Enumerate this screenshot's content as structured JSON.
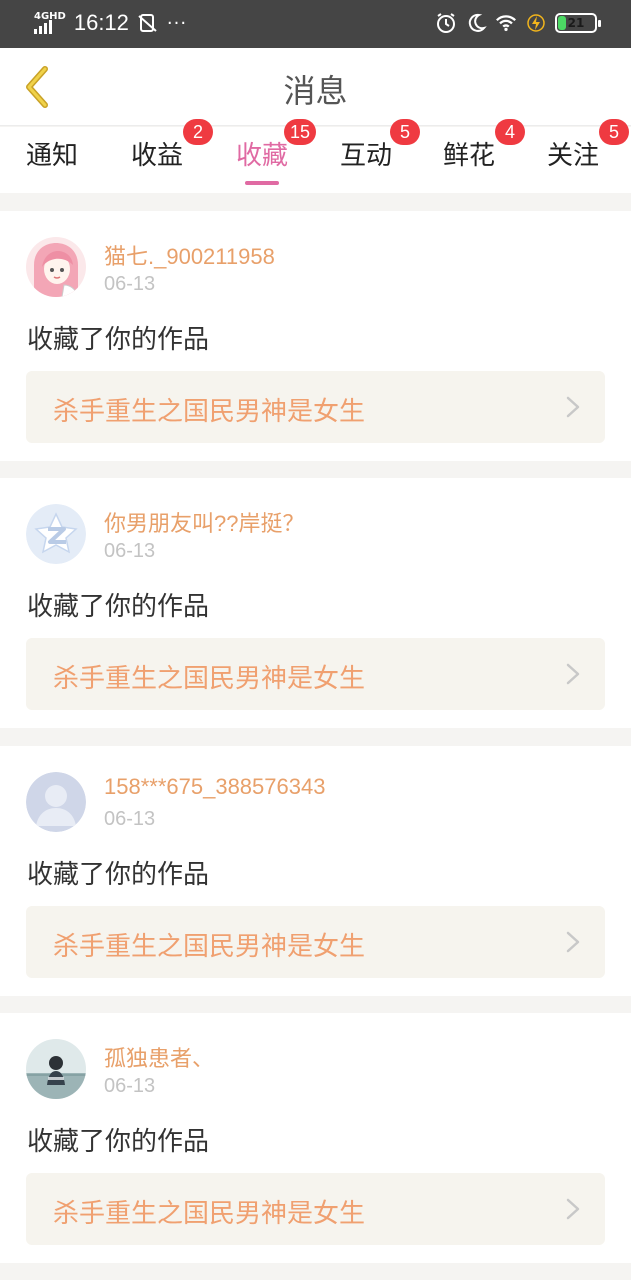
{
  "status_bar": {
    "network": "4GHD",
    "time": "16:12",
    "sim_icon": "sim-off-icon",
    "more": "···",
    "battery": "21"
  },
  "header": {
    "title": "消息"
  },
  "tabs": [
    {
      "label": "通知",
      "badge": ""
    },
    {
      "label": "收益",
      "badge": "2"
    },
    {
      "label": "收藏",
      "badge": "15",
      "active": true
    },
    {
      "label": "互动",
      "badge": "5"
    },
    {
      "label": "鲜花",
      "badge": "4"
    },
    {
      "label": "关注",
      "badge": "5"
    }
  ],
  "colors": {
    "accent": "#e06aa3",
    "badge": "#ef3a41",
    "username": "#e8a06a",
    "work_title": "#f0a070"
  },
  "items": [
    {
      "username": "猫七._900211958",
      "date": "06-13",
      "action": "收藏了你的作品",
      "work": "杀手重生之国民男神是女生",
      "avatar": "anime-girl-avatar"
    },
    {
      "username": "你男朋友叫??岸挺？",
      "date": "06-13",
      "action": "收藏了你的作品",
      "work": "杀手重生之国民男神是女生",
      "avatar": "qzone-star-avatar"
    },
    {
      "username": "158***675_388576343",
      "date": "06-13",
      "action": "收藏了你的作品",
      "work": "杀手重生之国民男神是女生",
      "avatar": "default-person-avatar"
    },
    {
      "username": "孤独患者、",
      "date": "06-13",
      "action": "收藏了你的作品",
      "work": "杀手重生之国民男神是女生",
      "avatar": "photo-avatar"
    }
  ]
}
